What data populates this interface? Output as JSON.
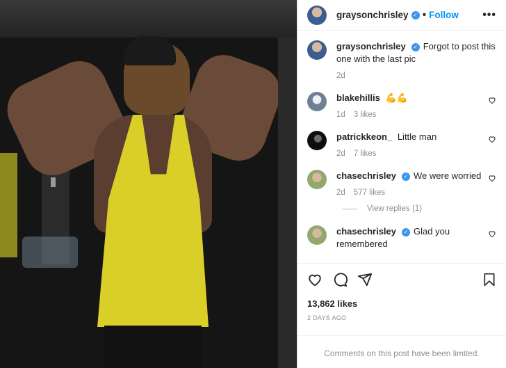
{
  "post": {
    "author": "graysonchrisley",
    "follow_label": "Follow",
    "more_label": "•••",
    "caption": {
      "user": "graysonchrisley",
      "text": "Forgot to post this one with the last pic",
      "time": "2d"
    }
  },
  "comments": [
    {
      "user": "blakehillis",
      "text": "💪💪",
      "time": "1d",
      "likes": "3 likes",
      "verified": false
    },
    {
      "user": "patrickkeon_",
      "text": "Little man",
      "time": "2d",
      "likes": "7 likes",
      "verified": false
    },
    {
      "user": "chasechrisley",
      "text": "We were worried",
      "time": "2d",
      "likes": "577 likes",
      "verified": true,
      "view_replies": "View replies (1)"
    },
    {
      "user": "chasechrisley",
      "text": "Glad you remembered",
      "time": "",
      "likes": "",
      "verified": true
    }
  ],
  "footer": {
    "likes": "13,862 likes",
    "date": "2 DAYS AGO",
    "limited": "Comments on this post have been limited."
  },
  "icons": [
    "heart-icon",
    "comment-icon",
    "share-icon",
    "bookmark-icon",
    "verified-badge-icon",
    "more-icon"
  ]
}
